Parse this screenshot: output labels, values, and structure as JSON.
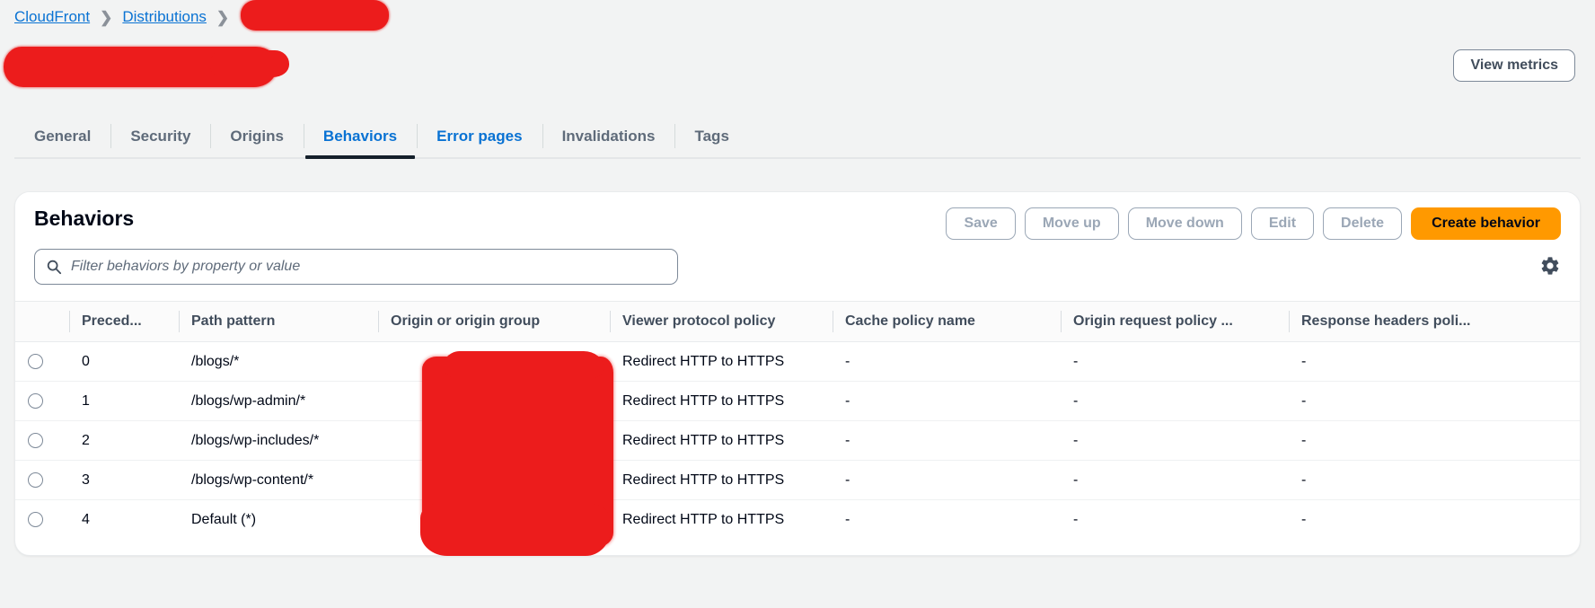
{
  "breadcrumb": {
    "items": [
      {
        "label": "CloudFront"
      },
      {
        "label": "Distributions"
      }
    ],
    "separator": "❯",
    "redacted_tail": ""
  },
  "header": {
    "view_metrics_label": "View metrics"
  },
  "tabs": [
    {
      "label": "General",
      "state": "normal"
    },
    {
      "label": "Security",
      "state": "normal"
    },
    {
      "label": "Origins",
      "state": "normal"
    },
    {
      "label": "Behaviors",
      "state": "active"
    },
    {
      "label": "Error pages",
      "state": "blue"
    },
    {
      "label": "Invalidations",
      "state": "normal"
    },
    {
      "label": "Tags",
      "state": "normal"
    }
  ],
  "panel": {
    "title": "Behaviors",
    "actions": [
      {
        "label": "Save",
        "variant": "normal"
      },
      {
        "label": "Move up",
        "variant": "normal"
      },
      {
        "label": "Move down",
        "variant": "normal"
      },
      {
        "label": "Edit",
        "variant": "normal"
      },
      {
        "label": "Delete",
        "variant": "normal"
      },
      {
        "label": "Create behavior",
        "variant": "primary"
      }
    ],
    "search": {
      "placeholder": "Filter behaviors by property or value",
      "value": "",
      "icon": "search-icon"
    },
    "settings_icon": "gear-icon"
  },
  "table": {
    "columns": [
      "Preced...",
      "Path pattern",
      "Origin or origin group",
      "Viewer protocol policy",
      "Cache policy name",
      "Origin request policy ...",
      "Response headers poli..."
    ],
    "rows": [
      {
        "precedence": "0",
        "path_pattern": "/blogs/*",
        "origin": "",
        "viewer_protocol_policy": "Redirect HTTP to HTTPS",
        "cache_policy_name": "-",
        "origin_request_policy": "-",
        "response_headers_policy": "-"
      },
      {
        "precedence": "1",
        "path_pattern": "/blogs/wp-admin/*",
        "origin": "",
        "viewer_protocol_policy": "Redirect HTTP to HTTPS",
        "cache_policy_name": "-",
        "origin_request_policy": "-",
        "response_headers_policy": "-"
      },
      {
        "precedence": "2",
        "path_pattern": "/blogs/wp-includes/*",
        "origin": "",
        "viewer_protocol_policy": "Redirect HTTP to HTTPS",
        "cache_policy_name": "-",
        "origin_request_policy": "-",
        "response_headers_policy": "-"
      },
      {
        "precedence": "3",
        "path_pattern": "/blogs/wp-content/*",
        "origin": "",
        "viewer_protocol_policy": "Redirect HTTP to HTTPS",
        "cache_policy_name": "-",
        "origin_request_policy": "-",
        "response_headers_policy": "-"
      },
      {
        "precedence": "4",
        "path_pattern": "Default (*)",
        "origin": "",
        "viewer_protocol_policy": "Redirect HTTP to HTTPS",
        "cache_policy_name": "-",
        "origin_request_policy": "-",
        "response_headers_policy": "-"
      }
    ]
  },
  "colors": {
    "link": "#0972d3",
    "primary_button": "#ff9900",
    "redaction": "#ec1c1c",
    "page_background": "#f2f3f3",
    "active_tab_underline": "#15202b"
  }
}
